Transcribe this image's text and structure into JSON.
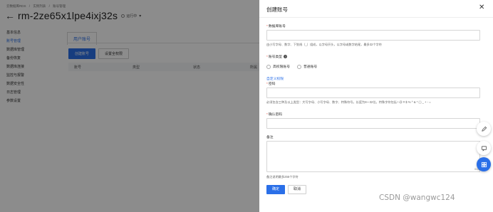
{
  "breadcrumb": [
    "云数据库RDS",
    "/",
    "实例列表",
    "/",
    "账号管理"
  ],
  "header": {
    "instance_id": "rm-2ze65x1lpe4ixj32s",
    "status": "运行中"
  },
  "sidebar": {
    "items": [
      {
        "label": "基本信息",
        "active": false
      },
      {
        "label": "账号管理",
        "active": true
      },
      {
        "label": "数据库管理",
        "active": false
      },
      {
        "label": "备份恢复",
        "active": false
      },
      {
        "label": "数据库连接",
        "active": false
      },
      {
        "label": "监控与报警",
        "active": false
      },
      {
        "label": "数据安全性",
        "active": false
      },
      {
        "label": "日志管理",
        "active": false
      },
      {
        "label": "参数设置",
        "active": false
      }
    ]
  },
  "main": {
    "tab_label": "用户账号",
    "create_button": "创建账号",
    "permission_button": "设置全权限",
    "columns": [
      "账号",
      "类型",
      "状态",
      "所属"
    ]
  },
  "drawer": {
    "title": "创建账号",
    "username_label": "数据库账号",
    "username_hint": "由小写字母、数字、下划线（_）组成，以字母开头，以字母或数字结尾，最多32个字符",
    "account_type_label": "账号类型",
    "type_options": [
      "高权限账号",
      "普通账号"
    ],
    "custom_link": "自定义权限",
    "password_label": "密码",
    "password_hint": "必须包含三种及以上类型：大写字母、小写字母、数字、特殊符号。长度为8～32位。特殊字符包括 ! @ # $ % ^ & * ( ) _ + - =",
    "confirm_label": "确认密码",
    "remark_label": "备注",
    "remark_grip": "0/256",
    "remark_hint": "备注说明最多256个字符",
    "ok_button": "确定",
    "cancel_button": "取消"
  },
  "watermark": "CSDN @wangwc124",
  "colors": {
    "accent": "#2a6fe8",
    "required": "#e34b3c"
  },
  "icons": [
    "close-icon",
    "help-icon",
    "edit-icon",
    "chat-icon",
    "apps-icon",
    "back-arrow-icon"
  ]
}
